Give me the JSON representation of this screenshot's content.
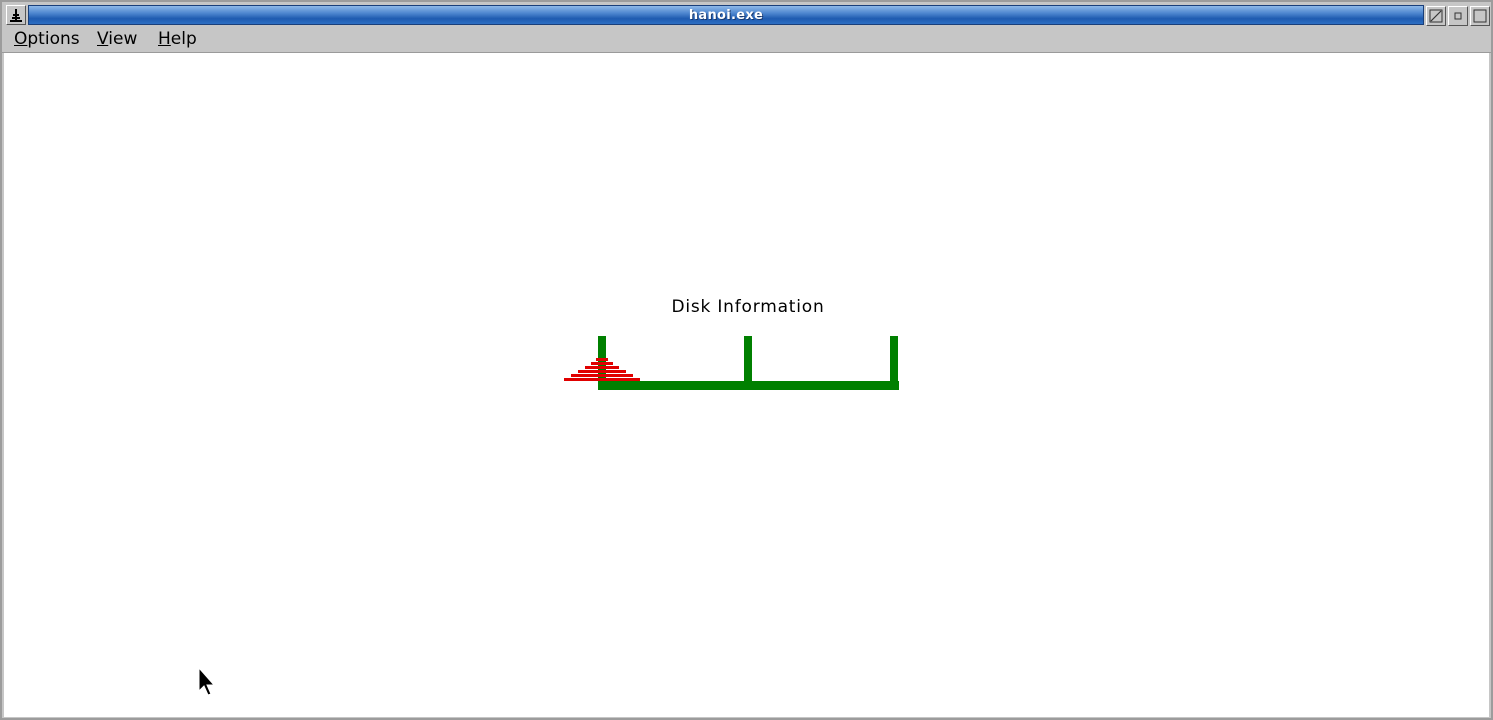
{
  "window": {
    "title": "hanoi.exe"
  },
  "menu": {
    "items": [
      {
        "label": "Options",
        "accel": "O",
        "rest": "ptions"
      },
      {
        "label": "View",
        "accel": "V",
        "rest": "iew"
      },
      {
        "label": "Help",
        "accel": "H",
        "rest": "elp"
      }
    ]
  },
  "content": {
    "heading": "Disk Information"
  },
  "game": {
    "pegs": 3,
    "disks_on_peg": [
      6,
      0,
      0
    ],
    "peg_color": "#008000",
    "disk_color": "#e00000"
  },
  "icons": {
    "system_menu": "hanoi-tower-icon",
    "buttons": [
      "iconify-icon",
      "maximize-small-icon",
      "maximize-icon"
    ],
    "cursor": "arrow-cursor-icon"
  }
}
